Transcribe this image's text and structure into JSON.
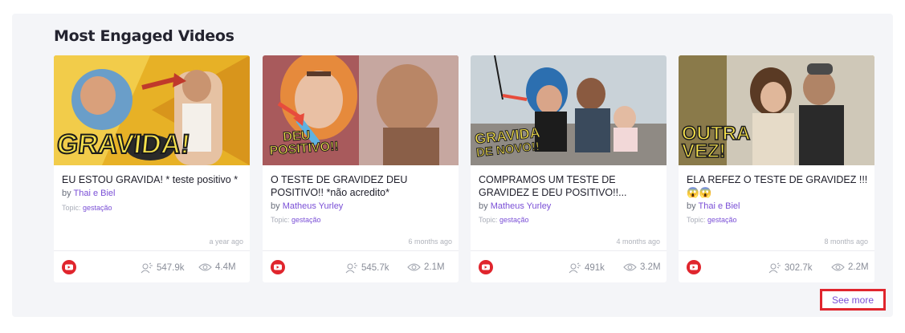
{
  "section": {
    "title": "Most Engaged Videos"
  },
  "cards": [
    {
      "title": "EU ESTOU GRAVIDA! * teste positivo *",
      "by": "by",
      "author": "Thai e Biel",
      "topic_label": "Topic:",
      "topic": "gestação",
      "age": "a year ago",
      "engagement": "547.9k",
      "views": "4.4M",
      "thumb_text": [
        "GRAVIDA!"
      ],
      "thumb_colors": {
        "bg": "#e7b126",
        "accent": "#c0392b"
      }
    },
    {
      "title": "O TESTE DE GRAVIDEZ DEU POSITIVO!! *não acredito*",
      "by": "by",
      "author": "Matheus Yurley",
      "topic_label": "Topic:",
      "topic": "gestação",
      "age": "6 months ago",
      "engagement": "545.7k",
      "views": "2.1M",
      "thumb_text": [
        "DEU",
        "POSITIVO!!"
      ],
      "thumb_colors": {
        "bg": "#b86a68",
        "accent": "#e74c3c"
      }
    },
    {
      "title": "COMPRAMOS UM TESTE DE GRAVIDEZ E DEU POSITIVO!!...",
      "by": "by",
      "author": "Matheus Yurley",
      "topic_label": "Topic:",
      "topic": "gestação",
      "age": "4 months ago",
      "engagement": "491k",
      "views": "3.2M",
      "thumb_text": [
        "GRAVIDA",
        "DE NOVO!!"
      ],
      "thumb_colors": {
        "bg": "#c9d2d8",
        "accent": "#2c6fb0"
      }
    },
    {
      "title": "ELA REFEZ O TESTE DE GRAVIDEZ !!! 😱😱",
      "by": "by",
      "author": "Thai e Biel",
      "topic_label": "Topic:",
      "topic": "gestação",
      "age": "8 months ago",
      "engagement": "302.7k",
      "views": "2.2M",
      "thumb_text": [
        "OUTRA",
        "VEZ!"
      ],
      "thumb_colors": {
        "bg": "#d9a431",
        "accent": "#6a5a3a"
      }
    }
  ],
  "see_more": "See more",
  "colors": {
    "accent": "#7a4fd6",
    "youtube": "#e0252d",
    "highlight": "#e0252d"
  },
  "icons": {
    "platform": "youtube-icon",
    "engagement": "engagement-icon",
    "views": "eye-icon"
  }
}
